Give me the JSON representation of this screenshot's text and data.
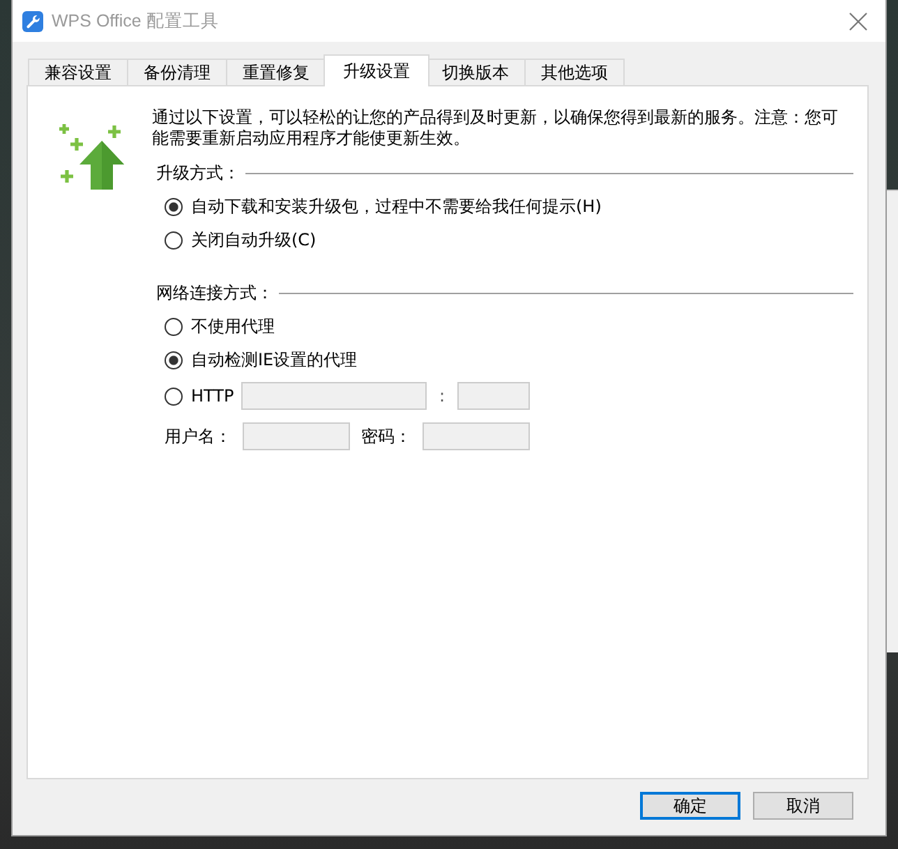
{
  "window": {
    "title": "WPS Office 配置工具"
  },
  "tabs": [
    {
      "label": "兼容设置",
      "selected": false
    },
    {
      "label": "备份清理",
      "selected": false
    },
    {
      "label": "重置修复",
      "selected": false
    },
    {
      "label": "升级设置",
      "selected": true
    },
    {
      "label": "切换版本",
      "selected": false
    },
    {
      "label": "其他选项",
      "selected": false
    }
  ],
  "upgrade_panel": {
    "description": "通过以下设置，可以轻松的让您的产品得到及时更新，以确保您得到最新的服务。注意：您可能需要重新启动应用程序才能使更新生效。",
    "upgrade_method": {
      "heading": "升级方式：",
      "options": [
        {
          "label": "自动下载和安装升级包，过程中不需要给我任何提示(H)",
          "selected": true
        },
        {
          "label": "关闭自动升级(C)",
          "selected": false
        }
      ]
    },
    "network": {
      "heading": "网络连接方式：",
      "options": [
        {
          "kind": "plain",
          "label": "不使用代理",
          "selected": false
        },
        {
          "kind": "plain",
          "label": "自动检测IE设置的代理",
          "selected": true
        },
        {
          "kind": "http",
          "label": "HTTP",
          "selected": false
        }
      ],
      "host_field": {
        "disabled": true
      },
      "port_separator": ":",
      "port_field": {
        "disabled": true
      },
      "username_label": "用户名：",
      "username_field": {
        "disabled": true
      },
      "password_label": "密码：",
      "password_field": {
        "disabled": true
      }
    }
  },
  "buttons": [
    {
      "label": "确定",
      "default": true
    },
    {
      "label": "取消",
      "default": false
    }
  ]
}
